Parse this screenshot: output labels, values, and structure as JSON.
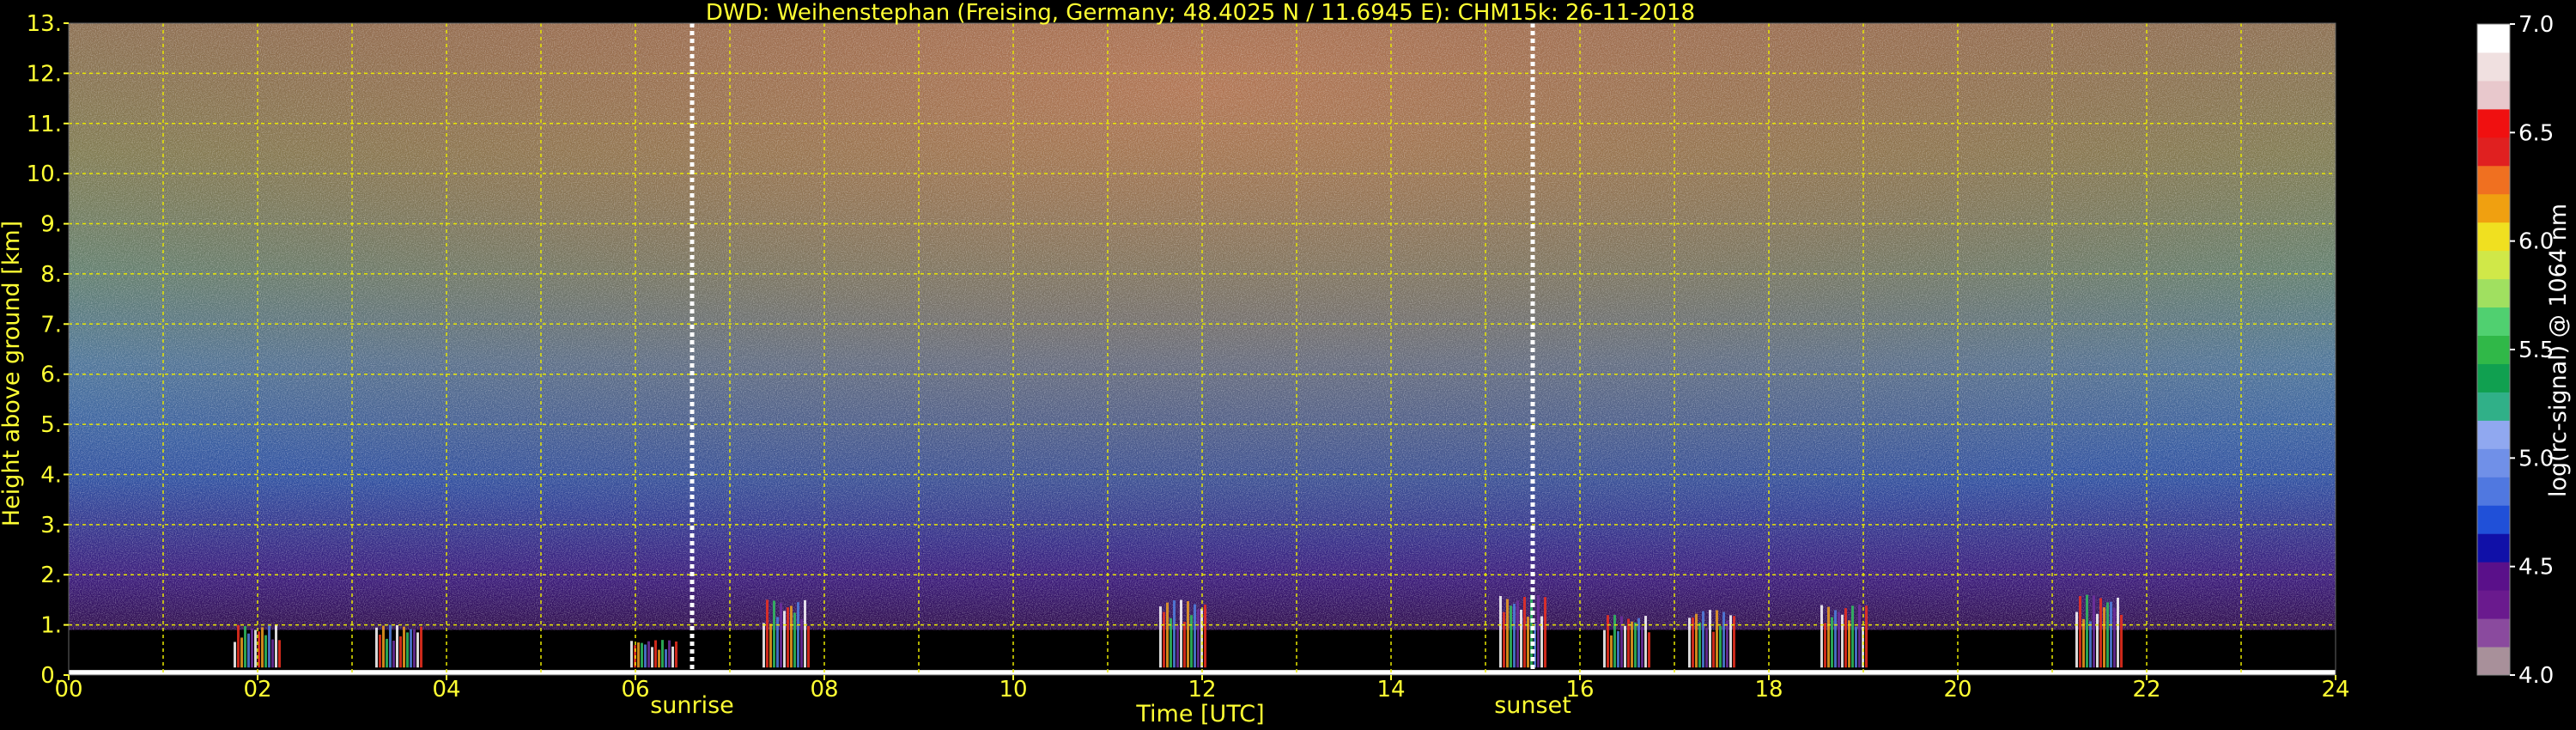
{
  "chart_data": {
    "type": "heatmap",
    "title": "DWD: Weihenstephan (Freising, Germany; 48.4025 N / 11.6945 E):    CHM15k: 26-11-2018",
    "xlabel": "Time [UTC]",
    "ylabel": "Height above ground [km]",
    "xlim": [
      0,
      24
    ],
    "ylim": [
      0,
      13
    ],
    "x_ticks": [
      "00",
      "02",
      "04",
      "06",
      "08",
      "10",
      "12",
      "14",
      "16",
      "18",
      "20",
      "22",
      "24"
    ],
    "y_ticks": [
      "0.",
      "1.",
      "2.",
      "3.",
      "4.",
      "5.",
      "6.",
      "7.",
      "8.",
      "9.",
      "10.",
      "11.",
      "12.",
      "13."
    ],
    "grid": true,
    "markers": [
      {
        "label": "sunrise",
        "time": 6.6
      },
      {
        "label": "sunset",
        "time": 15.5
      }
    ],
    "colorbar": {
      "label": "log(rc-signal) @ 1064 nm",
      "range": [
        4.0,
        7.0
      ],
      "ticks": [
        "4.0",
        "4.5",
        "5.0",
        "5.5",
        "6.0",
        "6.5",
        "7.0"
      ],
      "colors": [
        "#a8909a",
        "#8a4a9e",
        "#6a1a8e",
        "#5a108a",
        "#1010a8",
        "#2050d8",
        "#5078e0",
        "#7090e8",
        "#90a8f0",
        "#30b088",
        "#10a050",
        "#30b848",
        "#50d070",
        "#a0e060",
        "#d0e848",
        "#f0e020",
        "#f0a010",
        "#f07020",
        "#e02020",
        "#f01010",
        "#e8c8cc",
        "#f0e0e0",
        "#ffffff"
      ]
    },
    "noise_profile": {
      "note": "",
      "colors": []
    },
    "cloud_events": [
      {
        "time": 2.0,
        "top": 1.0
      },
      {
        "time": 3.5,
        "top": 1.0
      },
      {
        "time": 6.2,
        "top": 0.7
      },
      {
        "time": 7.6,
        "top": 1.5
      },
      {
        "time": 11.8,
        "top": 1.5
      },
      {
        "time": 15.4,
        "top": 1.6
      },
      {
        "time": 16.5,
        "top": 1.2
      },
      {
        "time": 17.4,
        "top": 1.3
      },
      {
        "time": 18.8,
        "top": 1.4
      },
      {
        "time": 21.5,
        "top": 1.6
      }
    ]
  }
}
